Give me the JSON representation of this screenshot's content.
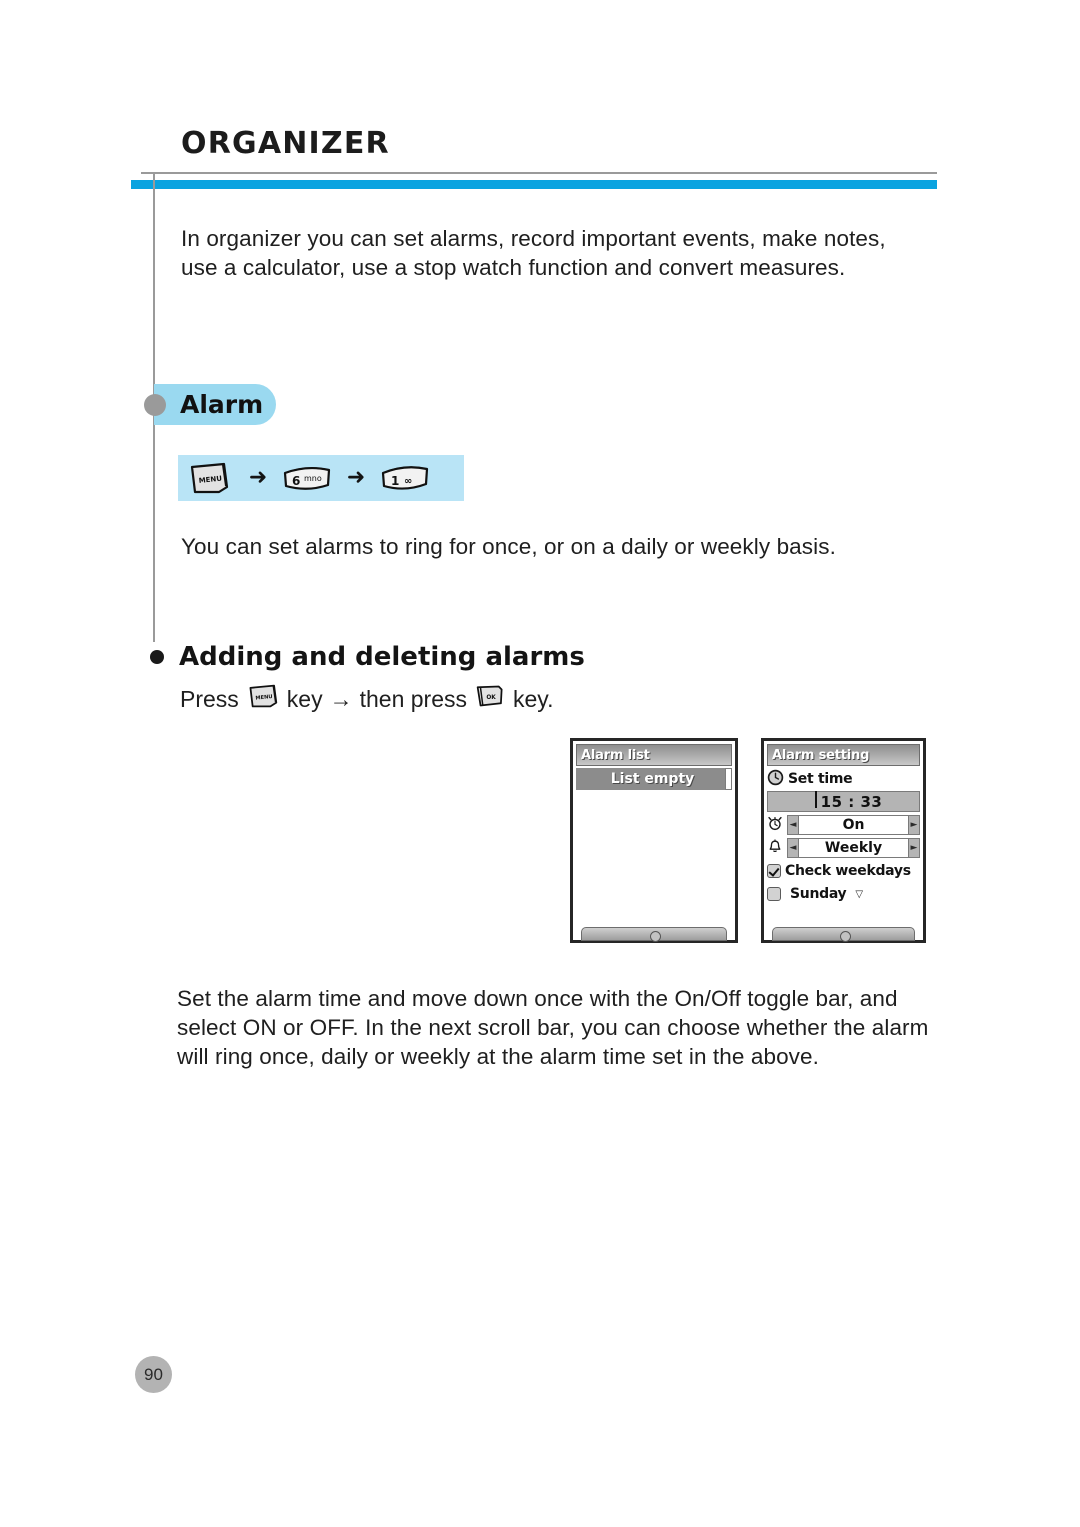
{
  "document": {
    "chapter_title": "ORGANIZER",
    "page_number": "90",
    "accent_blue": "#0aa3e0",
    "pill_blue": "#9ad9f0",
    "strip_blue": "#b9e4f6",
    "rule_gray": "#9a9a9a"
  },
  "intro": {
    "paragraph": "In organizer you can set alarms, record important events, make notes, use a calculator, use a stop watch function and convert measures."
  },
  "alarm_section": {
    "title": "Alarm",
    "key_sequence": [
      {
        "type": "key",
        "label": "MENU",
        "sub": ""
      },
      {
        "type": "arrow",
        "label": "➜"
      },
      {
        "type": "key",
        "label": "6",
        "sub": "mno"
      },
      {
        "type": "arrow",
        "label": "➜"
      },
      {
        "type": "key",
        "label": "1",
        "sub": "∞"
      }
    ],
    "description": "You can set alarms to ring for once, or on a daily or weekly basis."
  },
  "subsection": {
    "heading": "Adding and deleting alarms",
    "press_prefix": "Press",
    "press_key_1": "MENU",
    "press_mid_1": "key",
    "press_arrow": "→",
    "press_mid_2": "then press",
    "press_key_2": "OK",
    "press_suffix": "key."
  },
  "phone_screens": {
    "alarm_list": {
      "title": "Alarm list",
      "rows": [
        {
          "label": "List empty",
          "selected": true
        }
      ]
    },
    "alarm_setting": {
      "title": "Alarm setting",
      "set_time_label": "Set time",
      "set_time_value": "15 : 33",
      "toggle": {
        "value": "On",
        "left_arrow": "◄",
        "right_arrow": "►"
      },
      "repeat": {
        "value": "Weekly",
        "left_arrow": "◄",
        "right_arrow": "►"
      },
      "check_weekdays": {
        "label": "Check weekdays",
        "checked": true
      },
      "sunday": {
        "label": "Sunday",
        "checked": false,
        "caret": "▽"
      }
    }
  },
  "closing": {
    "paragraph": "Set the alarm time and move down once with the On/Off toggle bar, and select ON or OFF. In the next scroll bar, you can choose whether the alarm will ring once, daily or weekly at the alarm time set in the above."
  }
}
